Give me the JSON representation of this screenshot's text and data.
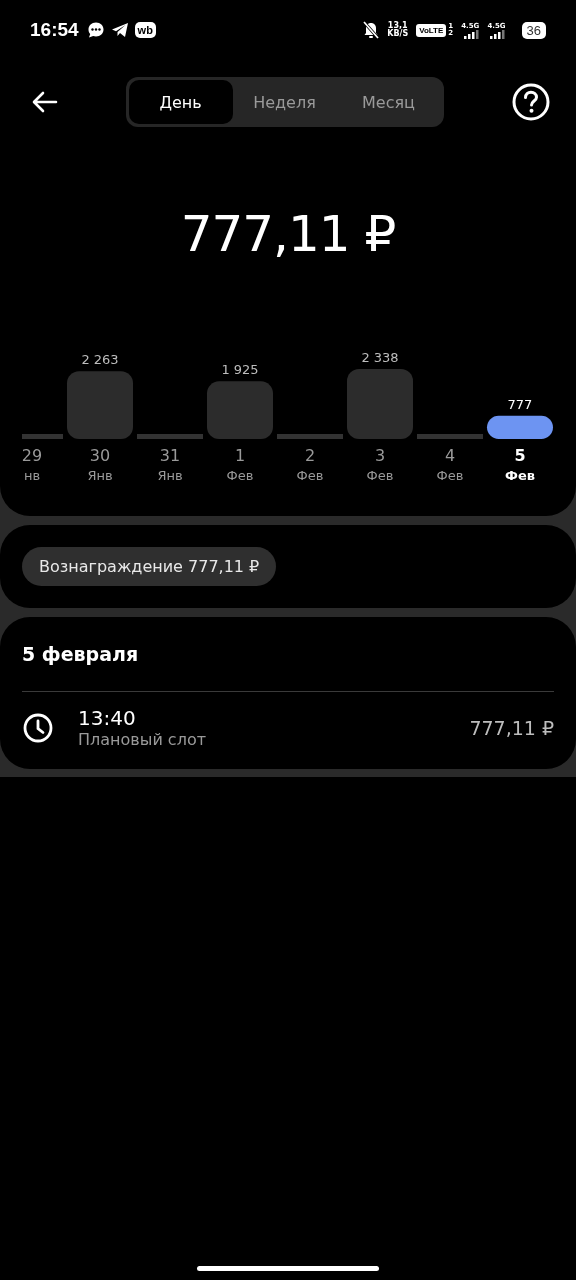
{
  "status_bar": {
    "time": "16:54",
    "app_badge": "wb",
    "net_speed": "13,1",
    "net_unit": "KB/S",
    "volte": "VoLTE",
    "sim_1": "1",
    "sim_2": "2",
    "network_1": "4.5G",
    "network_2": "4.5G",
    "battery": "36"
  },
  "header": {
    "tabs": [
      {
        "label": "День",
        "selected": true
      },
      {
        "label": "Неделя",
        "selected": false
      },
      {
        "label": "Месяц",
        "selected": false
      }
    ]
  },
  "total": "777,11 ₽",
  "chart": {
    "bars": [
      {
        "selected": false
      },
      {
        "selected": false
      },
      {
        "selected": false
      },
      {
        "selected": false
      },
      {
        "selected": false
      },
      {
        "selected": false
      },
      {
        "selected": false
      },
      {
        "selected": true
      }
    ],
    "chart_data": {
      "type": "bar",
      "categories": [
        "29\nнв",
        "30\nЯнв",
        "31\nЯнв",
        "1\nФев",
        "2\nФев",
        "3\nФев",
        "4\nФев",
        "5\nФев"
      ],
      "values": [
        0,
        2263,
        0,
        1925,
        0,
        2338,
        0,
        777
      ],
      "value_labels": [
        null,
        "2 263",
        null,
        "1 925",
        null,
        "2 338",
        null,
        "777"
      ],
      "data_labels": true
    }
  },
  "reward_chip": "Вознаграждение 777,11 ₽",
  "day": {
    "title": "5 февраля",
    "entries": [
      {
        "time": "13:40",
        "type": "Плановый слот",
        "amount": "777,11 ₽"
      }
    ]
  }
}
